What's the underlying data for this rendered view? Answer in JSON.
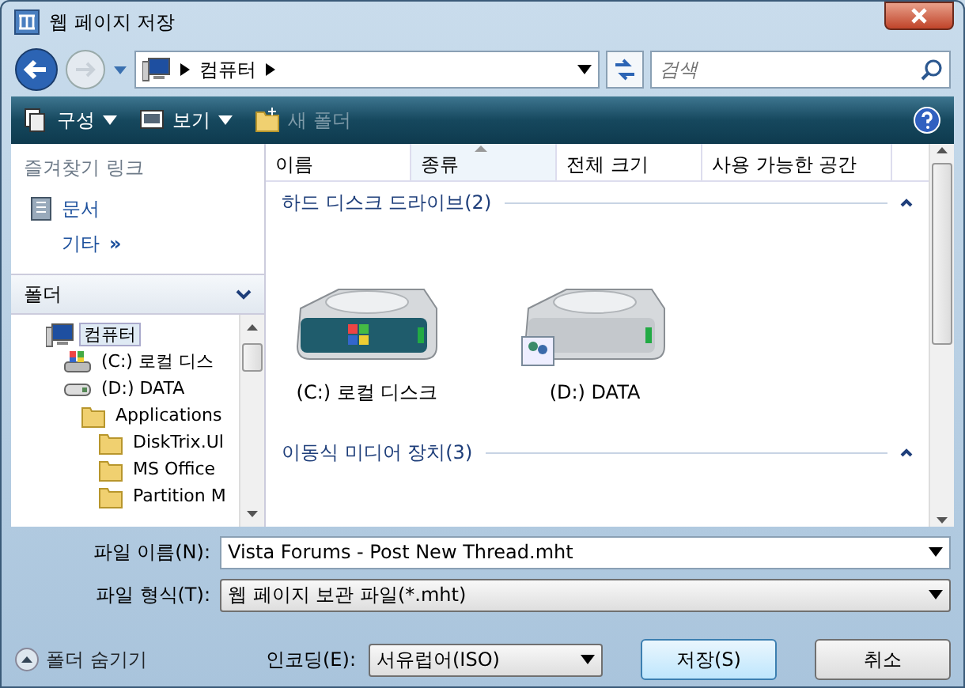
{
  "window": {
    "title": "웹 페이지 저장"
  },
  "address": {
    "path": [
      "컴퓨터"
    ]
  },
  "search": {
    "placeholder": "검색"
  },
  "toolbar": [
    {
      "label": "구성",
      "kind": "organize",
      "disabled": false
    },
    {
      "label": "보기",
      "kind": "view",
      "disabled": false
    },
    {
      "label": "새 폴더",
      "kind": "newfolder",
      "disabled": true
    }
  ],
  "favorites": {
    "title": "즐겨찾기 링크",
    "items": [
      {
        "label": "문서",
        "kind": "documents"
      },
      {
        "label": "기타",
        "kind": "more",
        "suffix": "»"
      }
    ]
  },
  "folders": {
    "title": "폴더",
    "tree": [
      {
        "label": "컴퓨터",
        "kind": "computer",
        "selected": true,
        "children": [
          {
            "label": "(C:) 로컬 디스",
            "kind": "system",
            "selected": false
          },
          {
            "label": "(D:) DATA",
            "kind": "drive",
            "selected": false,
            "children": [
              {
                "label": "Applications",
                "kind": "folder",
                "selected": false,
                "children": [
                  {
                    "label": "DiskTrix.Ul",
                    "kind": "folder",
                    "selected": false
                  },
                  {
                    "label": "MS Office",
                    "kind": "folder",
                    "selected": false
                  },
                  {
                    "label": "Partition M",
                    "kind": "folder",
                    "selected": false
                  }
                ]
              }
            ]
          }
        ]
      }
    ]
  },
  "columns": [
    {
      "label": "이름",
      "sorted": false
    },
    {
      "label": "종류",
      "sorted": true
    },
    {
      "label": "전체 크기",
      "sorted": false
    },
    {
      "label": "사용 가능한 공간",
      "sorted": false
    }
  ],
  "groups": [
    {
      "title": "하드 디스크 드라이브(2)",
      "expanded": true,
      "items": [
        {
          "label": "(C:) 로컬 디스크",
          "kind": "system"
        },
        {
          "label": "(D:) DATA",
          "kind": "shared"
        }
      ]
    },
    {
      "title": "이동식 미디어 장치(3)",
      "expanded": true
    }
  ],
  "form": [
    {
      "label": "파일 이름(N):",
      "value": "Vista Forums - Post New Thread.mht",
      "kind": "edit"
    },
    {
      "label": "파일 형식(T):",
      "value": "웹 페이지 보관 파일(*.mht)",
      "kind": "select"
    }
  ],
  "footer": {
    "toggle": "폴더 숨기기",
    "encoding": {
      "label": "인코딩(E):",
      "value": "서유럽어(ISO)"
    },
    "buttons": [
      {
        "label": "저장(S)",
        "default": true
      },
      {
        "label": "취소",
        "default": false
      }
    ]
  }
}
